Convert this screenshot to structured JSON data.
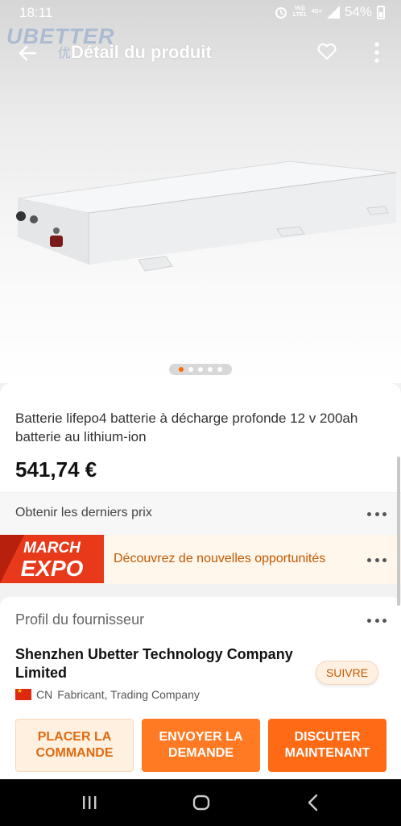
{
  "status_bar": {
    "time": "18:11",
    "net_top": "Vo))",
    "net_bottom": "LTE1",
    "net_gen": "4G+",
    "battery": "54%"
  },
  "brand": {
    "watermark": "UBETTER",
    "watermark_sub": "优"
  },
  "header": {
    "title": "Détail du produit"
  },
  "gallery": {
    "image_count": 5,
    "active_index": 0
  },
  "product": {
    "title": "Batterie lifepo4 batterie à décharge profonde 12 v 200ah batterie au lithium-ion",
    "price": "541,74 €"
  },
  "latest_prices": {
    "label": "Obtenir les derniers prix"
  },
  "expo": {
    "line1": "MARCH",
    "line2": "EXPO",
    "text": "Découvrez de nouvelles opportunités"
  },
  "supplier": {
    "heading": "Profil du fournisseur",
    "name": "Shenzhen Ubetter Technology Company Limited",
    "follow_label": "SUIVRE",
    "country": "CN",
    "type": "Fabricant, Trading Company"
  },
  "actions": {
    "order": "PLACER LA COMMANDE",
    "inquiry": "ENVOYER LA DEMANDE",
    "chat": "DISCUTER MAINTENANT"
  },
  "colors": {
    "accent": "#ff6a14",
    "accent_light": "#fff0e0",
    "expo_red": "#e8391a"
  },
  "icons": [
    "back-arrow-icon",
    "heart-icon",
    "more-vertical-icon",
    "more-horizontal-icon",
    "recent-apps-icon",
    "home-icon",
    "nav-back-icon"
  ]
}
